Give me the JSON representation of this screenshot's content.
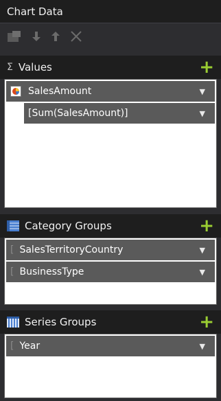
{
  "panel": {
    "title": "Chart Data"
  },
  "toolbar": {
    "icons": [
      "properties-icon",
      "move-down-icon",
      "move-up-icon",
      "delete-icon"
    ]
  },
  "values": {
    "title": "Values",
    "field": "SalesAmount",
    "expression": "[Sum(SalesAmount)]"
  },
  "category_groups": {
    "title": "Category Groups",
    "items": [
      "SalesTerritoryCountry",
      "BusinessType"
    ]
  },
  "series_groups": {
    "title": "Series Groups",
    "items": [
      "Year"
    ]
  },
  "colors": {
    "accent_add": "#9acd32",
    "header_bg": "#1e1e1e",
    "row_bg": "#5a5a5a"
  }
}
